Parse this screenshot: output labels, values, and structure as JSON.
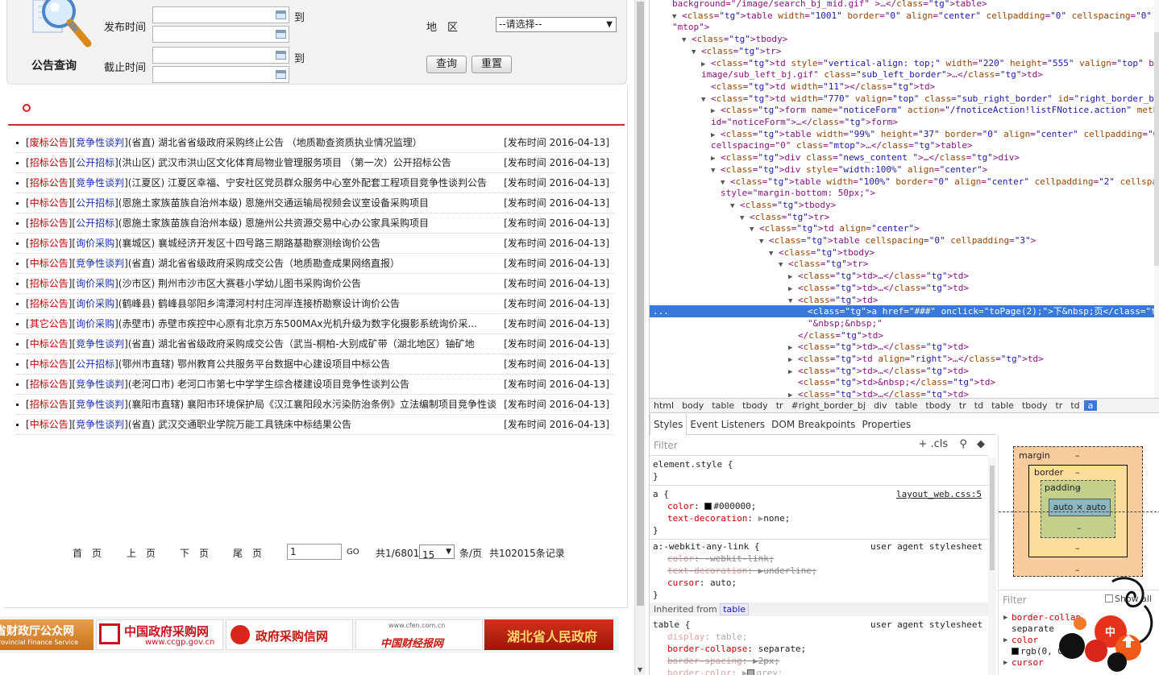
{
  "search": {
    "logo_caption": "公告查询",
    "publish_time_label": "发布时间",
    "deadline_label": "截止时间",
    "to_label_1": "到",
    "to_label_2": "到",
    "region_label": "地　区",
    "region_selected": "--请选择--",
    "query_button": "查询",
    "reset_button": "重置"
  },
  "notices": [
    {
      "type": "废标公告",
      "method": "竞争性谈判",
      "title": "(省直) 湖北省省级政府采购终止公告 （地质勘查资质执业情况监理）",
      "date": "[发布时间 2016-04-13]"
    },
    {
      "type": "招标公告",
      "method": "公开招标",
      "title": "(洪山区) 武汉市洪山区文化体育局物业管理服务项目 （第一次）公开招标公告",
      "date": "[发布时间 2016-04-13]"
    },
    {
      "type": "招标公告",
      "method": "竞争性谈判",
      "title": "(江夏区) 江夏区幸福、宁安社区党员群众服务中心室外配套工程项目竞争性谈判公告",
      "date": "[发布时间 2016-04-13]"
    },
    {
      "type": "中标公告",
      "method": "公开招标",
      "title": "(恩施土家族苗族自治州本级) 恩施州交通运输局视频会议室设备采购项目",
      "date": "[发布时间 2016-04-13]"
    },
    {
      "type": "招标公告",
      "method": "公开招标",
      "title": "(恩施土家族苗族自治州本级) 恩施州公共资源交易中心办公家具采购项目",
      "date": "[发布时间 2016-04-13]"
    },
    {
      "type": "招标公告",
      "method": "询价采购",
      "title": "(襄城区) 襄城经济开发区十四号路三期路基勘察测绘询价公告",
      "date": "[发布时间 2016-04-13]"
    },
    {
      "type": "中标公告",
      "method": "竞争性谈判",
      "title": "(省直) 湖北省省级政府采购成交公告（地质勘查成果网络直报）",
      "date": "[发布时间 2016-04-13]"
    },
    {
      "type": "招标公告",
      "method": "询价采购",
      "title": "(沙市区) 荆州市沙市区大赛巷小学幼儿图书采购询价公告",
      "date": "[发布时间 2016-04-13]"
    },
    {
      "type": "招标公告",
      "method": "询价采购",
      "title": "(鹤峰县) 鹤峰县邬阳乡湾潭河村村庄河岸连接桥勘察设计询价公告",
      "date": "[发布时间 2016-04-13]"
    },
    {
      "type": "其它公告",
      "method": "询价采购",
      "title": "(赤壁市) 赤壁市疾控中心原有北京万东500MAx光机升级为数字化摄影系统询价采...",
      "date": "[发布时间 2016-04-13]"
    },
    {
      "type": "中标公告",
      "method": "竞争性谈判",
      "title": "(省直) 湖北省省级政府采购成交公告（武当-桐柏-大别成矿带（湖北地区）铀矿地",
      "date": "[发布时间 2016-04-13]"
    },
    {
      "type": "中标公告",
      "method": "公开招标",
      "title": "(鄂州市直辖) 鄂州教育公共服务平台数据中心建设项目中标公告",
      "date": "[发布时间 2016-04-13]"
    },
    {
      "type": "招标公告",
      "method": "竞争性谈判",
      "title": "(老河口市) 老河口市第七中学学生综合楼建设项目竞争性谈判公告",
      "date": "[发布时间 2016-04-13]"
    },
    {
      "type": "招标公告",
      "method": "竞争性谈判",
      "title": "(襄阳市直辖) 襄阳市环境保护局《汉江襄阳段水污染防治条例》立法编制项目竞争性谈",
      "date": "[发布时间 2016-04-13]"
    },
    {
      "type": "中标公告",
      "method": "竞争性谈判",
      "title": "(省直) 武汉交通职业学院万能工具铣床中标结果公告",
      "date": "[发布时间 2016-04-13]"
    }
  ],
  "pager": {
    "first": "首　页",
    "prev": "上　页",
    "next": "下　页",
    "last": "尾　页",
    "page_value": "1",
    "go": "GO",
    "total_pages": "共1/6801",
    "page_size": "15",
    "per_page": "条/页",
    "total_records": "共102015条记录"
  },
  "banners": [
    {
      "label": "省财政厅公众网",
      "sub": "rovincial Finance Service"
    },
    {
      "label": "中国政府采购网",
      "sub": "www.ccgp.gov.cn"
    },
    {
      "label": "政府采购信网"
    },
    {
      "label": "中国财经报网",
      "sub": "www.cfen.com.cn"
    },
    {
      "label": "湖北省人民政府"
    }
  ],
  "devtools": {
    "dom_lines": [
      {
        "indent": 28,
        "tri": "",
        "html": "background=\"/image/search_bj_mid.gif\" >…</table>"
      },
      {
        "indent": 28,
        "tri": "▼",
        "html": "<table width=\"1001\" border=\"0\" align=\"center\" cellpadding=\"0\" cellspacing=\"0\" class="
      },
      {
        "indent": 28,
        "tri": "",
        "html": "\"mtop\">"
      },
      {
        "indent": 40,
        "tri": "▼",
        "html": "<tbody>"
      },
      {
        "indent": 52,
        "tri": "▼",
        "html": "<tr>"
      },
      {
        "indent": 64,
        "tri": "▶",
        "html": "<td style=\"vertical-align: top;\" width=\"220\" height=\"555\" valign=\"top\" background=\"/"
      },
      {
        "indent": 64,
        "tri": "",
        "html": "image/sub_left_bj.gif\" class=\"sub_left_border\">…</td>"
      },
      {
        "indent": 76,
        "tri": "",
        "html": "<td width=\"11\"></td>"
      },
      {
        "indent": 64,
        "tri": "▼",
        "html": "<td width=\"770\" valign=\"top\" class=\"sub_right_border\" id=\"right_border_bj\">"
      },
      {
        "indent": 76,
        "tri": "▶",
        "html": "<form name=\"noticeForm\" action=\"/fnoticeAction!listFNotice.action\" method=\"post\""
      },
      {
        "indent": 76,
        "tri": "",
        "html": "id=\"noticeForm\">…</form>"
      },
      {
        "indent": 76,
        "tri": "▶",
        "html": "<table width=\"99%\" height=\"37\" border=\"0\" align=\"center\" cellpadding=\"0\""
      },
      {
        "indent": 76,
        "tri": "",
        "html": "cellspacing=\"0\" class=\"mtop\">…</table>"
      },
      {
        "indent": 76,
        "tri": "▶",
        "html": "<div class=\"news_content \">…</div>"
      },
      {
        "indent": 76,
        "tri": "▼",
        "html": "<div style=\"width:100%\" align=\"center\">"
      },
      {
        "indent": 88,
        "tri": "▼",
        "html": "<table width=\"100%\" border=\"0\" align=\"center\" cellpadding=\"2\" cellspacing=\"3\""
      },
      {
        "indent": 88,
        "tri": "",
        "html": "style=\"margin-bottom: 50px;\">"
      },
      {
        "indent": 100,
        "tri": "▼",
        "html": "<tbody>"
      },
      {
        "indent": 112,
        "tri": "▼",
        "html": "<tr>"
      },
      {
        "indent": 124,
        "tri": "▼",
        "html": "<td align=\"center\">"
      },
      {
        "indent": 136,
        "tri": "▼",
        "html": "<table cellspacing=\"0\" cellpadding=\"3\">"
      },
      {
        "indent": 148,
        "tri": "▼",
        "html": "<tbody>"
      },
      {
        "indent": 160,
        "tri": "▼",
        "html": "<tr>"
      },
      {
        "indent": 172,
        "tri": "▶",
        "html": "<td>…</td>"
      },
      {
        "indent": 172,
        "tri": "▶",
        "html": "<td>…</td>"
      },
      {
        "indent": 172,
        "tri": "▼",
        "html": "<td>"
      },
      {
        "indent": 196,
        "tri": "",
        "html": "<a href=\"###\" onclick=\"toPage(2);\">下&nbsp;页</a>",
        "selected": true
      },
      {
        "indent": 196,
        "tri": "",
        "html": "\"&nbsp;&nbsp;\""
      },
      {
        "indent": 184,
        "tri": "",
        "html": "</td>"
      },
      {
        "indent": 172,
        "tri": "▶",
        "html": "<td>…</td>"
      },
      {
        "indent": 172,
        "tri": "▶",
        "html": "<td align=\"right\">…</td>"
      },
      {
        "indent": 172,
        "tri": "▶",
        "html": "<td>…</td>"
      },
      {
        "indent": 184,
        "tri": "",
        "html": "<td>&nbsp;</td>"
      },
      {
        "indent": 172,
        "tri": "▶",
        "html": "<td>…</td>"
      }
    ],
    "selected_marker": "...",
    "breadcrumbs": [
      "html",
      "body",
      "table",
      "tbody",
      "tr",
      "#right_border_bj",
      "div",
      "table",
      "tbody",
      "tr",
      "td",
      "table",
      "tbody",
      "tr",
      "td",
      "a"
    ],
    "tabs": [
      "Styles",
      "Event Listeners",
      "DOM Breakpoints",
      "Properties"
    ],
    "filter_placeholder": "Filter",
    "filter_tools": "+ .cls",
    "styles": {
      "element_style": "element.style {",
      "close1": "}",
      "a_selector": "a {",
      "a_source": "layout_web.css:5",
      "a_color_prop": "color",
      "a_color_val": "#000000;",
      "a_textdec_prop": "text-decoration",
      "a_textdec_val": "none;",
      "close2": "}",
      "webkit_selector": "a:-webkit-any-link {",
      "webkit_source": "user agent stylesheet",
      "webkit_color_prop": "color",
      "webkit_color_val": "-webkit-link;",
      "webkit_textdec_prop": "text-decoration",
      "webkit_textdec_val": "underline;",
      "webkit_cursor_prop": "cursor",
      "webkit_cursor_val": "auto;",
      "close3": "}",
      "inherited_label": "Inherited from",
      "inherited_tag": "table",
      "table_selector": "table {",
      "table_source": "user agent stylesheet",
      "table_display_prop": "display",
      "table_display_val": "table;",
      "table_collapse_prop": "border-collapse",
      "table_collapse_val": "separate;",
      "table_spacing_prop": "border-spacing",
      "table_spacing_val": "2px;",
      "table_bcolor_prop": "border-color",
      "table_bcolor_val": "grey;"
    },
    "box_model": {
      "margin": "margin",
      "border": "border",
      "padding": "padding",
      "content": "auto × auto",
      "dash": "–"
    },
    "computed": {
      "filter": "Filter",
      "show_all": "Show all",
      "lines": [
        {
          "prop": "border-collap",
          "val": "separate"
        },
        {
          "prop": "color",
          "val": "rgb(0, 0, 0)"
        },
        {
          "prop": "cursor",
          "val": "auto"
        }
      ]
    },
    "deco_text": "中"
  },
  "colors": {
    "accent_red": "#c0352b",
    "type_red": "#c00000",
    "method_blue": "#1a2fb0",
    "selection_blue": "#3879d9"
  }
}
